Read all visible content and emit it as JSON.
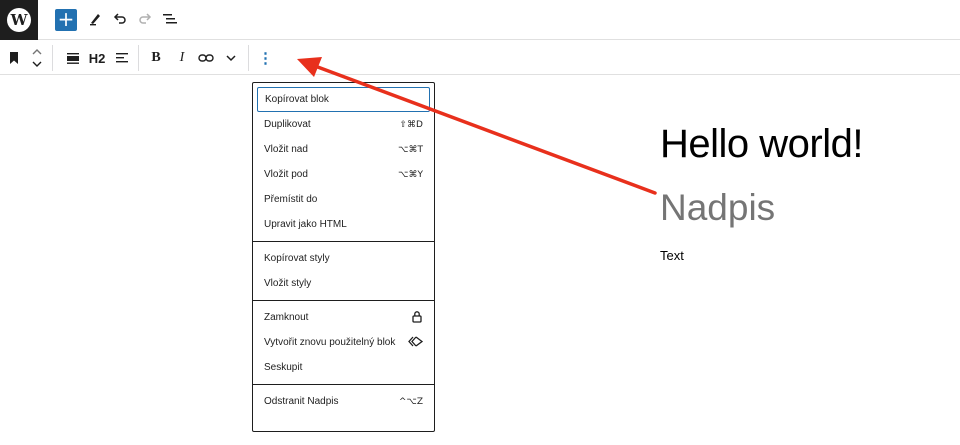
{
  "header": {
    "logo_letter": "W",
    "inserter_label": "+",
    "icons": [
      "wordpress-logo",
      "plus-icon",
      "pencil-icon",
      "undo-icon",
      "redo-icon",
      "list-view-icon"
    ]
  },
  "block_toolbar": {
    "heading_level": "H2",
    "bold_label": "B",
    "italic_label": "I",
    "more_label": "⋮"
  },
  "menu": {
    "groups": [
      {
        "items": [
          {
            "label": "Kopírovat blok",
            "shortcut": ""
          },
          {
            "label": "Duplikovat",
            "shortcut": "⇧⌘D"
          },
          {
            "label": "Vložit nad",
            "shortcut": "⌥⌘T"
          },
          {
            "label": "Vložit pod",
            "shortcut": "⌥⌘Y"
          },
          {
            "label": "Přemístit do",
            "shortcut": ""
          },
          {
            "label": "Upravit jako HTML",
            "shortcut": ""
          }
        ]
      },
      {
        "items": [
          {
            "label": "Kopírovat styly",
            "shortcut": ""
          },
          {
            "label": "Vložit styly",
            "shortcut": ""
          }
        ]
      },
      {
        "items": [
          {
            "label": "Zamknout",
            "shortcut": ""
          },
          {
            "label": "Vytvořit znovu použitelný blok",
            "shortcut": ""
          },
          {
            "label": "Seskupit",
            "shortcut": ""
          }
        ]
      },
      {
        "items": [
          {
            "label": "Odstranit Nadpis",
            "shortcut": "^⌥Z"
          }
        ]
      }
    ]
  },
  "content": {
    "post_title": "Hello world!",
    "heading": "Nadpis",
    "paragraph": "Text"
  },
  "colors": {
    "accent": "#2271b1",
    "annotation_arrow": "#e8301c"
  }
}
